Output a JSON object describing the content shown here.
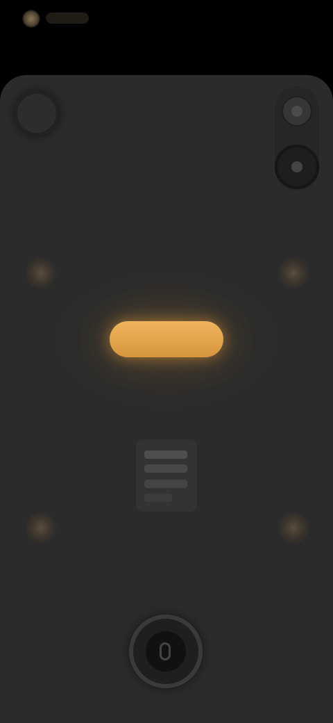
{
  "status_bar": {
    "text": ""
  },
  "controls": {
    "top_left_button": "circle-icon",
    "side_top_button": "dot-icon",
    "side_bottom_button": "dot-icon",
    "home_button": "power-icon"
  },
  "colors": {
    "background": "#2b2b2b",
    "status_bar": "#000000",
    "accent": "#e6a550"
  }
}
